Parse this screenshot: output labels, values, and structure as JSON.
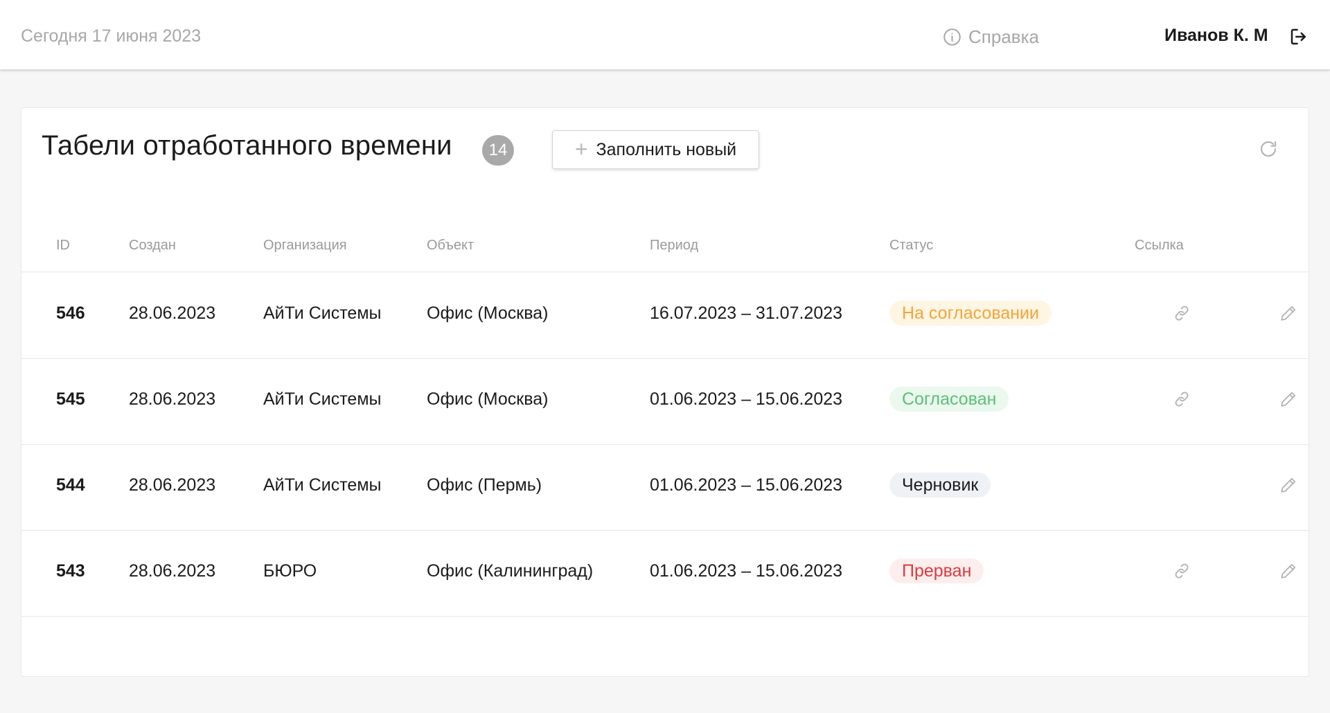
{
  "header": {
    "today": "Сегодня 17 июня 2023",
    "help_label": "Справка",
    "user_name": "Иванов К. М"
  },
  "page": {
    "title": "Табели отработанного времени",
    "count": "14",
    "new_button_label": "Заполнить новый"
  },
  "table": {
    "columns": [
      "ID",
      "Создан",
      "Организация",
      "Объект",
      "Период",
      "Статус",
      "Ссылка"
    ],
    "rows": [
      {
        "id": "546",
        "created": "28.06.2023",
        "org": "АйТи Системы",
        "object": "Офис (Москва)",
        "period": "16.07.2023 – 31.07.2023",
        "status": "На согласовании",
        "status_type": "pending",
        "has_link": true
      },
      {
        "id": "545",
        "created": "28.06.2023",
        "org": "АйТи Системы",
        "object": "Офис (Москва)",
        "period": "01.06.2023 – 15.06.2023",
        "status": "Согласован",
        "status_type": "approved",
        "has_link": true
      },
      {
        "id": "544",
        "created": "28.06.2023",
        "org": "АйТи Системы",
        "object": "Офис (Пермь)",
        "period": "01.06.2023 – 15.06.2023",
        "status": "Черновик",
        "status_type": "draft",
        "has_link": false
      },
      {
        "id": "543",
        "created": "28.06.2023",
        "org": "БЮРО",
        "object": "Офис (Калининград)",
        "period": "01.06.2023 – 15.06.2023",
        "status": "Прерван",
        "status_type": "aborted",
        "has_link": true
      }
    ]
  },
  "status_colors": {
    "pending": {
      "text": "#f3a53a",
      "bg": "#fff5e3"
    },
    "approved": {
      "text": "#5cbf78",
      "bg": "#eaf8ee"
    },
    "draft": {
      "text": "#1b1b1b",
      "bg": "#eef1f5"
    },
    "aborted": {
      "text": "#e0393c",
      "bg": "#fdeeee"
    }
  },
  "icons": {
    "help": "info-circle-icon",
    "logout": "logout-icon",
    "plus": "plus-icon",
    "refresh": "refresh-icon",
    "link": "link-icon",
    "edit": "pencil-icon"
  }
}
